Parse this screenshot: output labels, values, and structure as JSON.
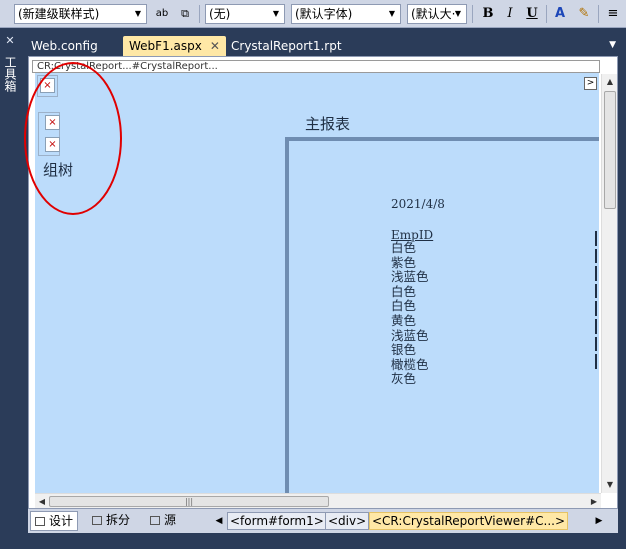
{
  "toolbar": {
    "style_select": "(新建级联样式)",
    "block_format": "(无)",
    "font_family": "(默认字体)",
    "font_size": "(默认大·",
    "bold": "B",
    "italic": "I",
    "underline": "U",
    "font_color": "A",
    "highlight": "✎",
    "align": "≡",
    "icons": [
      "style-apply-icon",
      "new-style-icon"
    ]
  },
  "toolbox": {
    "label": "工具箱",
    "pin": "✕"
  },
  "tabs": [
    {
      "label": "Web.config",
      "active": false
    },
    {
      "label": "WebF1.aspx",
      "active": true,
      "close": "✕"
    },
    {
      "label": "CrystalReport1.rpt",
      "active": false
    }
  ],
  "tab_dropdown": "▼",
  "pathbar": "CR:CrystalReport...#CrystalReport...",
  "designer": {
    "placeholder_glyph": "×",
    "group_tree_label": "组树",
    "main_report_title": "主报表",
    "expand_glyph": ">",
    "report_date": "2021/4/8",
    "column_header": "EmpID",
    "rows": [
      "白色",
      "紫色",
      "浅蓝色",
      "白色",
      "白色",
      "黄色",
      "浅蓝色",
      "银色",
      "橄榄色",
      "灰色"
    ]
  },
  "scrollbars": {
    "v_up": "▲",
    "v_down": "▼",
    "h_left": "◀",
    "h_right": "▶",
    "h_grip": "|||"
  },
  "bottom": {
    "design": "设计",
    "split": "拆分",
    "source": "源",
    "prev": "◀",
    "next": "▶",
    "crumbs": [
      "<form#form1>",
      "<div>",
      "<CR:CrystalReportViewer#C...>"
    ]
  },
  "colors": {
    "canvas": "#bcdcfb",
    "annotation": "#e00000",
    "report_border": "#6f8db1",
    "active_tab": "#ffe8a6"
  }
}
